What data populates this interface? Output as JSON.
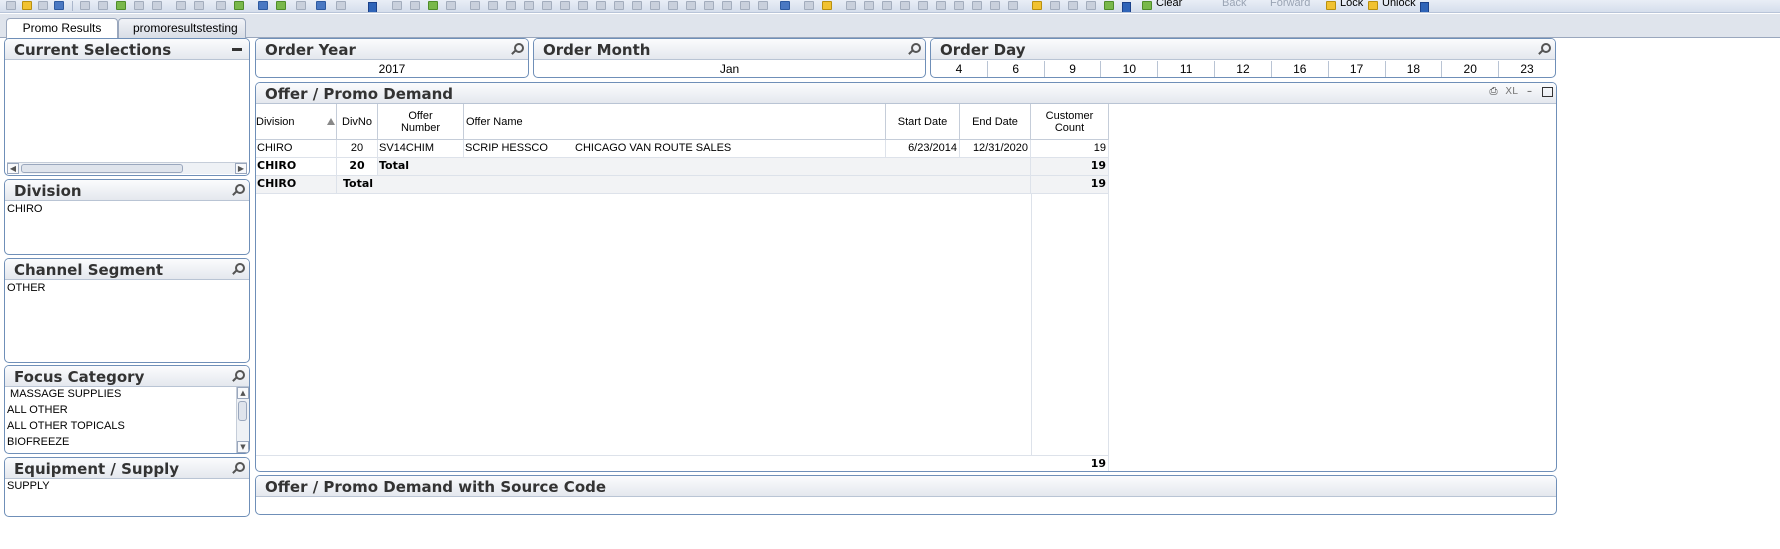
{
  "toolbar": {
    "clear_label": "Clear",
    "back_label": "Back",
    "forward_label": "Forward",
    "lock_label": "Lock",
    "unlock_label": "Unlock"
  },
  "tabs": [
    {
      "label": "Promo Results",
      "active": true
    },
    {
      "label": "promoresultstesting",
      "active": false
    }
  ],
  "panels": {
    "current_selections": {
      "title": "Current Selections"
    },
    "division": {
      "title": "Division",
      "items": [
        "CHIRO"
      ]
    },
    "channel_segment": {
      "title": "Channel Segment",
      "items": [
        "OTHER"
      ]
    },
    "focus_category": {
      "title": "Focus Category",
      "items": [
        " MASSAGE SUPPLIES",
        "ALL OTHER",
        "ALL OTHER TOPICALS",
        "BIOFREEZE"
      ]
    },
    "equipment_supply": {
      "title": "Equipment / Supply",
      "items": [
        "SUPPLY"
      ]
    }
  },
  "order_year": {
    "title": "Order Year",
    "value": "2017"
  },
  "order_month": {
    "title": "Order Month",
    "value": "Jan"
  },
  "order_day": {
    "title": "Order Day",
    "values": [
      "4",
      "6",
      "9",
      "10",
      "11",
      "12",
      "16",
      "17",
      "18",
      "20",
      "23"
    ]
  },
  "promo_demand": {
    "title": "Offer / Promo Demand",
    "xl_label": "XL",
    "headers": {
      "division": "Division",
      "divno": "DivNo",
      "offer_number_1": "Offer",
      "offer_number_2": "Number",
      "offer_name": "Offer Name",
      "start_date": "Start Date",
      "end_date": "End Date",
      "customer_count_1": "Customer",
      "customer_count_2": "Count"
    },
    "row1": {
      "division": "CHIRO",
      "divno": "20",
      "offer_number": "SV14CHIM",
      "offer_name": "SCRIP HESSCO",
      "offer_desc": "CHICAGO VAN ROUTE SALES",
      "start_date": "6/23/2014",
      "end_date": "12/31/2020",
      "customer_count": "19"
    },
    "subtotal": {
      "division": "CHIRO",
      "divno": "20",
      "label": "Total",
      "customer_count": "19"
    },
    "total": {
      "division": "CHIRO",
      "label": "Total",
      "customer_count": "19"
    },
    "grand_total": "19"
  },
  "promo_source": {
    "title": "Offer / Promo Demand with Source Code"
  },
  "colors": {
    "border": "#6f8fb8",
    "caption_bg": "#e4e8ee",
    "accent_blue": "#2f64b8"
  }
}
